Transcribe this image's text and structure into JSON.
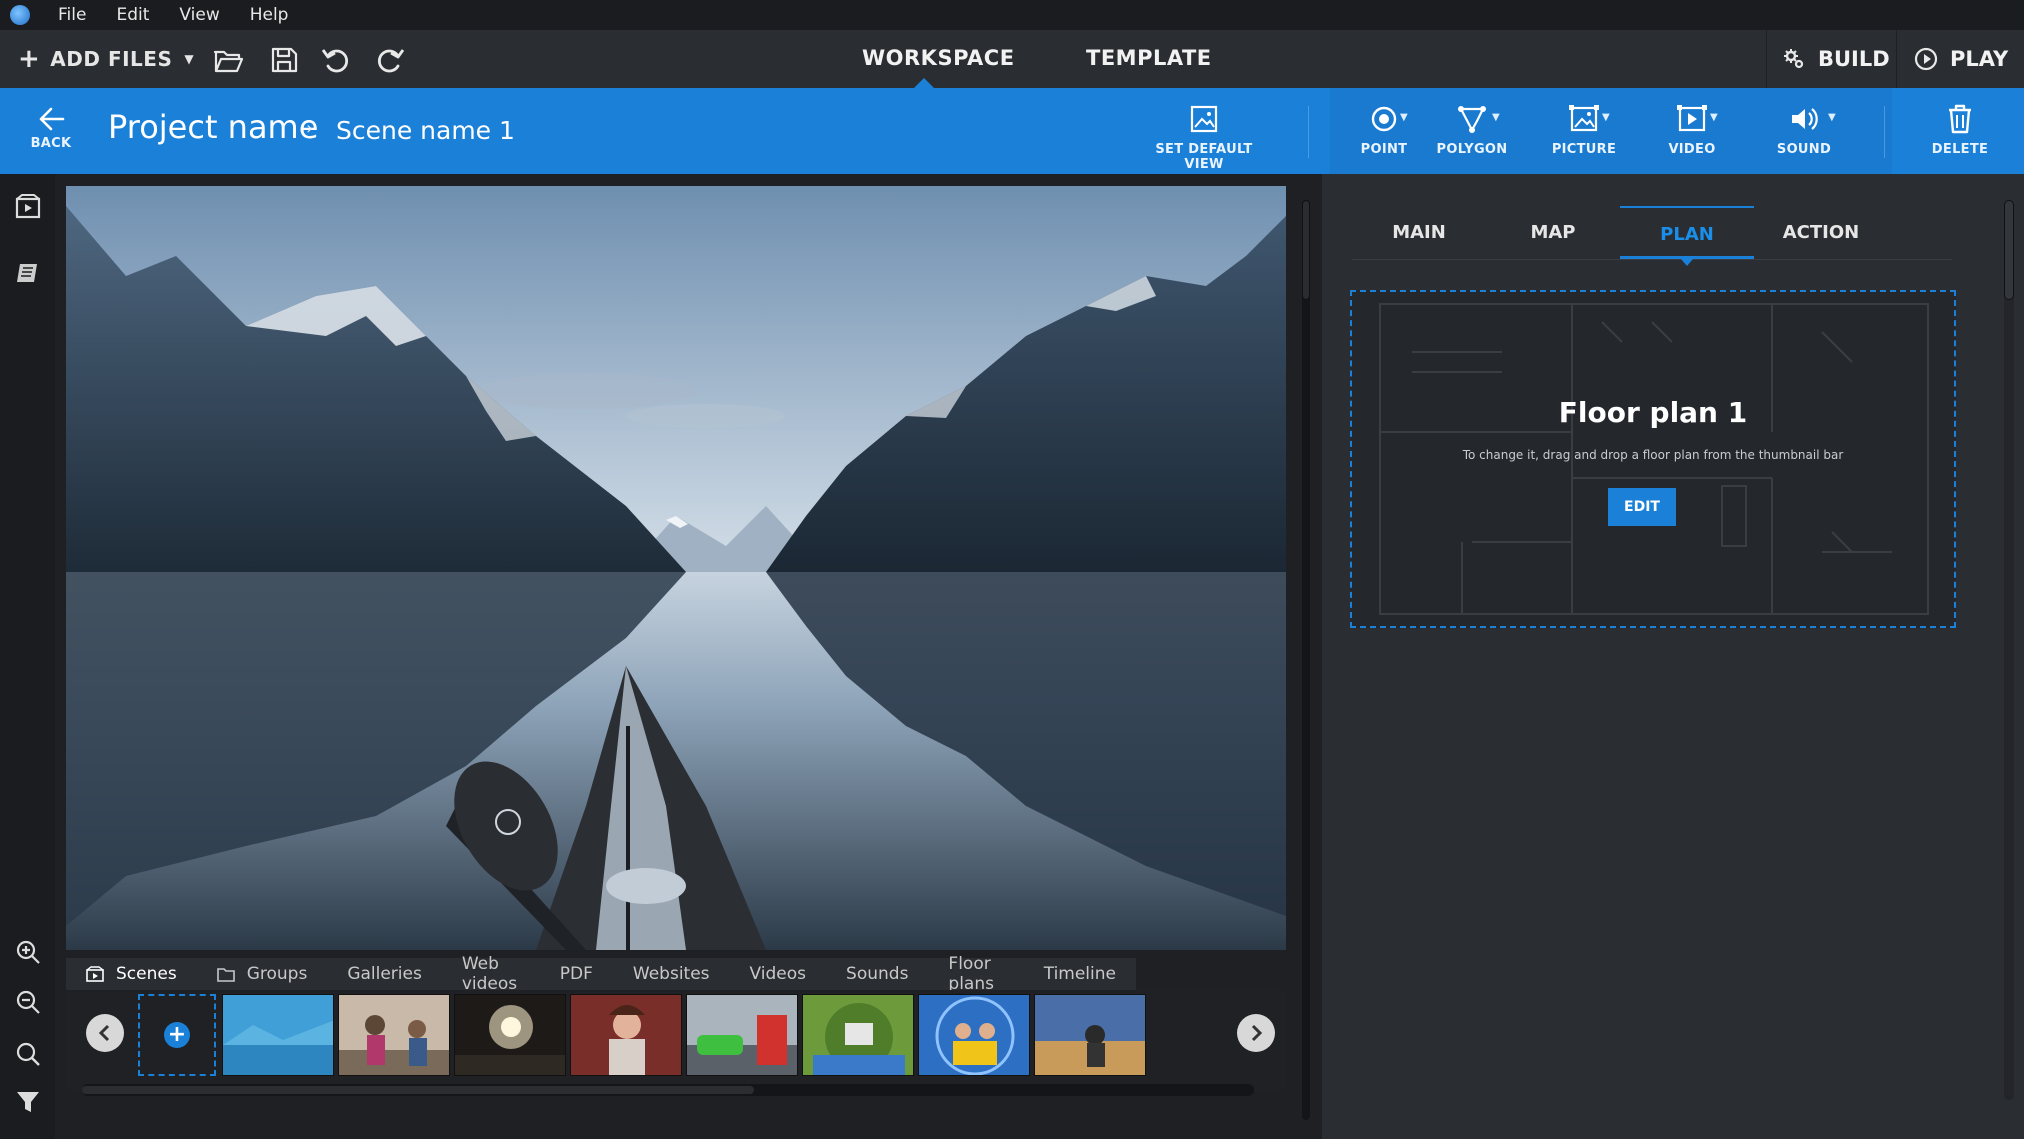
{
  "menubar": {
    "items": [
      "File",
      "Edit",
      "View",
      "Help"
    ]
  },
  "toolbar": {
    "add_files": "ADD FILES",
    "tabs": {
      "workspace": "WORKSPACE",
      "template": "TEMPLATE"
    },
    "build": "BUILD",
    "play": "PLAY"
  },
  "bluebar": {
    "back": "BACK",
    "project_name": "Project name",
    "separator": "›",
    "scene_name": "Scene name 1",
    "set_default_view": "SET DEFAULT VIEW",
    "tools": {
      "point": "POINT",
      "polygon": "POLYGON",
      "picture": "PICTURE",
      "video": "VIDEO",
      "sound": "SOUND"
    },
    "delete": "DELETE"
  },
  "library": {
    "tabs": [
      "Scenes",
      "Groups",
      "Galleries",
      "Web videos",
      "PDF",
      "Websites",
      "Videos",
      "Sounds",
      "Floor plans",
      "Timeline"
    ],
    "active_tab": "Scenes"
  },
  "rightpanel": {
    "tabs": [
      "MAIN",
      "MAP",
      "PLAN",
      "ACTION"
    ],
    "active_tab": "PLAN",
    "floorplan": {
      "title": "Floor plan 1",
      "hint": "To change it, drag and drop a floor plan from the thumbnail bar",
      "edit": "EDIT"
    }
  },
  "colors": {
    "accent": "#1a80d8",
    "background": "#1e2023",
    "panel": "#2a2d31"
  }
}
